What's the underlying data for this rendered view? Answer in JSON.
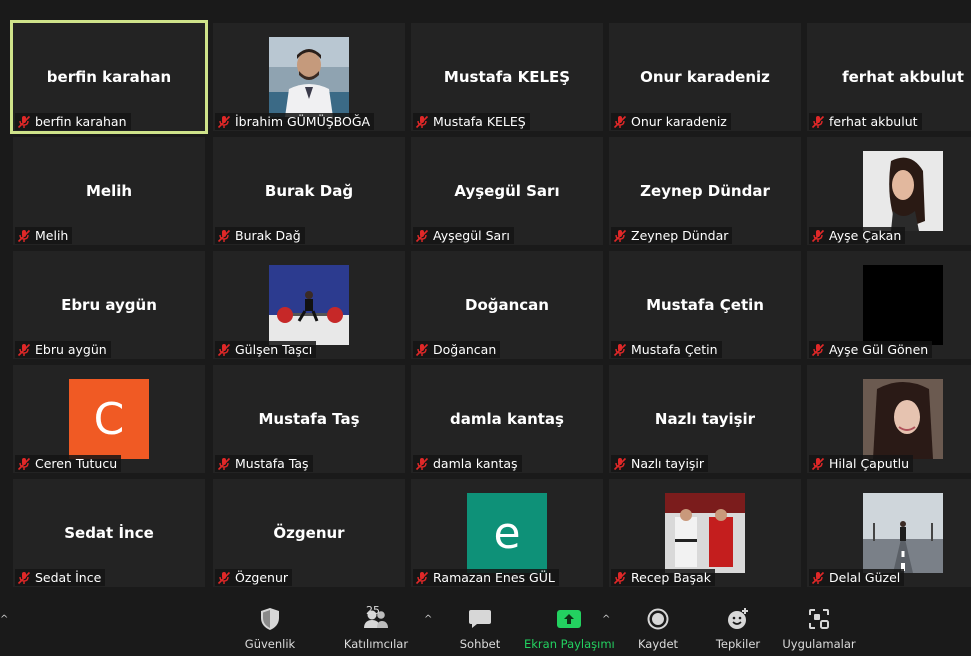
{
  "participants": [
    {
      "display": "berfin karahan",
      "label": "berfin karahan",
      "kind": "name",
      "active": true
    },
    {
      "display": "",
      "label": "İbrahim GÜMÜŞBOĞA",
      "kind": "photo",
      "photo": "man-portrait"
    },
    {
      "display": "Mustafa KELEŞ",
      "label": "Mustafa KELEŞ",
      "kind": "name"
    },
    {
      "display": "Onur karadeniz",
      "label": "Onur karadeniz",
      "kind": "name"
    },
    {
      "display": "ferhat akbulut",
      "label": "ferhat akbulut",
      "kind": "name"
    },
    {
      "display": "Melih",
      "label": "Melih",
      "kind": "name"
    },
    {
      "display": "Burak Dağ",
      "label": "Burak Dağ",
      "kind": "name"
    },
    {
      "display": "Ayşegül Sarı",
      "label": "Ayşegül Sarı",
      "kind": "name"
    },
    {
      "display": "Zeynep Dündar",
      "label": "Zeynep Dündar",
      "kind": "name"
    },
    {
      "display": "",
      "label": "Ayşe Çakan",
      "kind": "photo",
      "photo": "woman-portrait-light"
    },
    {
      "display": "Ebru aygün",
      "label": "Ebru aygün",
      "kind": "name"
    },
    {
      "display": "",
      "label": "Gülşen Taşcı",
      "kind": "photo",
      "photo": "weightlifting"
    },
    {
      "display": "Doğancan",
      "label": "Doğancan",
      "kind": "name"
    },
    {
      "display": "Mustafa Çetin",
      "label": "Mustafa Çetin",
      "kind": "name"
    },
    {
      "display": "",
      "label": "Ayşe Gül Gönen",
      "kind": "photo",
      "photo": "black"
    },
    {
      "display": "",
      "label": "Ceren Tutucu",
      "kind": "letter",
      "letter": "C",
      "color": "#f05a24"
    },
    {
      "display": "Mustafa Taş",
      "label": "Mustafa Taş",
      "kind": "name"
    },
    {
      "display": "damla kantaş",
      "label": "damla kantaş",
      "kind": "name"
    },
    {
      "display": "Nazlı tayişir",
      "label": "Nazlı tayişir",
      "kind": "name"
    },
    {
      "display": "",
      "label": "Hilal Çaputlu",
      "kind": "photo",
      "photo": "woman-portrait-dark"
    },
    {
      "display": "Sedat İnce",
      "label": "Sedat İnce",
      "kind": "name"
    },
    {
      "display": "Özgenur",
      "label": "Özgenur",
      "kind": "name"
    },
    {
      "display": "",
      "label": "Ramazan Enes GÜL",
      "kind": "letter",
      "letter": "e",
      "color": "#0e9178"
    },
    {
      "display": "",
      "label": "Recep Başak",
      "kind": "photo",
      "photo": "martial-arts"
    },
    {
      "display": "",
      "label": "Delal Güzel",
      "kind": "photo",
      "photo": "road"
    }
  ],
  "toolbar": {
    "security": {
      "label": "Güvenlik",
      "icon": "shield-icon"
    },
    "participants": {
      "label": "Katılımcılar",
      "count": "25",
      "icon": "people-icon"
    },
    "chat": {
      "label": "Sohbet",
      "icon": "chat-icon"
    },
    "share": {
      "label": "Ekran Paylaşımı",
      "icon": "share-arrow-icon",
      "color": "#23d160"
    },
    "record": {
      "label": "Kaydet",
      "icon": "record-icon"
    },
    "reactions": {
      "label": "Tepkiler",
      "icon": "smiley-plus-icon"
    },
    "apps": {
      "label": "Uygulamalar",
      "icon": "apps-icon"
    }
  },
  "colors": {
    "background": "#1a1a1a",
    "tile": "#232323",
    "active_border": "#cfe38a",
    "mute_red": "#e02828"
  }
}
